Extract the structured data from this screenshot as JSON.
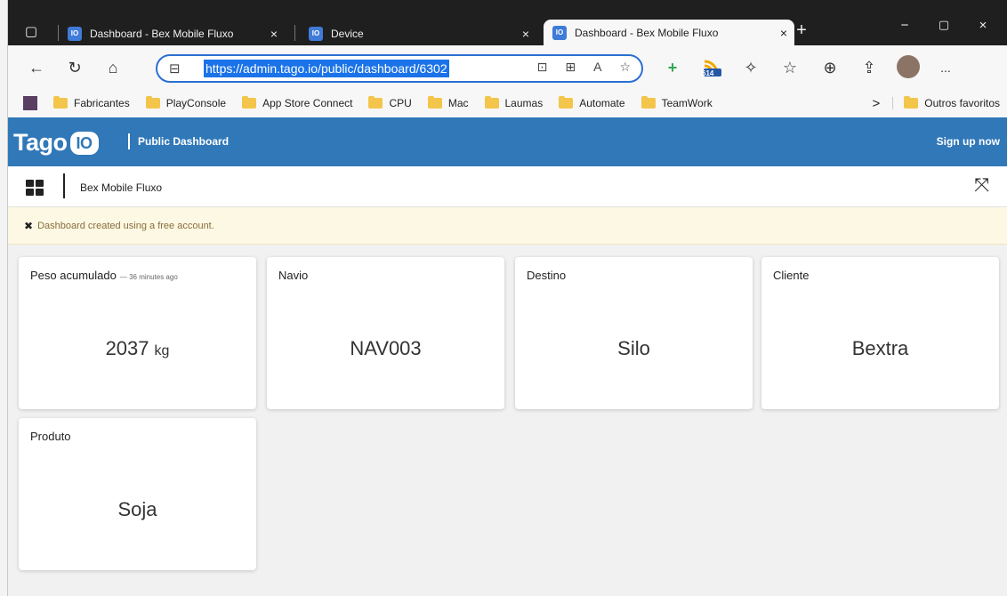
{
  "browser": {
    "tabs": [
      {
        "title": "Dashboard - Bex Mobile Fluxo",
        "icon": "tago-icon",
        "active": false
      },
      {
        "title": "Device",
        "icon": "tago-icon",
        "active": false
      },
      {
        "title": "Dashboard - Bex Mobile Fluxo",
        "icon": "tago-icon",
        "active": true
      }
    ],
    "tab_close_symbol": "×",
    "new_tab_symbol": "+",
    "favicon_text": "IO",
    "address": "https://admin.tago.io/public/dashboard/6302",
    "extension_badge": "614",
    "avatar": "profile-avatar",
    "more_menu": "...",
    "bookmarks": [
      "Fabricantes",
      "PlayConsole",
      "App Store Connect",
      "CPU",
      "Mac",
      "Laumas",
      "Automate",
      "TeamWork"
    ],
    "bookmarks_more": ">",
    "other_favorites": "Outros favoritos"
  },
  "app": {
    "logo_text": "Tago",
    "logo_box_text": "IO",
    "section": "Public Dashboard",
    "signup": "Sign up now"
  },
  "dashboard": {
    "title": "Bex Mobile Fluxo",
    "notice": "Dashboard created using a free account."
  },
  "widgets": [
    {
      "label": "Peso acumulado",
      "time": "— 36 minutes ago",
      "value": "2037",
      "unit": "kg"
    },
    {
      "label": "Navio",
      "value": "NAV003"
    },
    {
      "label": "Destino",
      "value": "Silo"
    },
    {
      "label": "Cliente",
      "value": "Bextra"
    },
    {
      "label": "Produto",
      "value": "Soja"
    }
  ],
  "colors": {
    "accent": "#3178B8",
    "notice_bg": "#FCF8E3",
    "url_highlight": "#1A73E8"
  }
}
